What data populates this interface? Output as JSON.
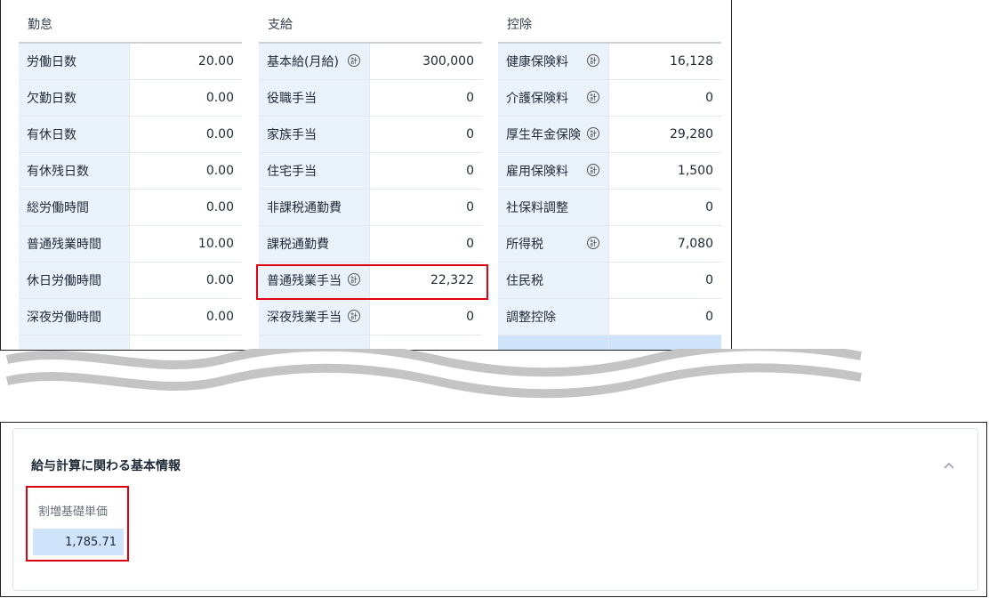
{
  "attendance": {
    "header": "勤怠",
    "rows": [
      {
        "label": "労働日数",
        "value": "20.00"
      },
      {
        "label": "欠勤日数",
        "value": "0.00"
      },
      {
        "label": "有休日数",
        "value": "0.00"
      },
      {
        "label": "有休残日数",
        "value": "0.00"
      },
      {
        "label": "総労働時間",
        "value": "0.00"
      },
      {
        "label": "普通残業時間",
        "value": "10.00"
      },
      {
        "label": "休日労働時間",
        "value": "0.00"
      },
      {
        "label": "深夜労働時間",
        "value": "0.00"
      }
    ]
  },
  "payment": {
    "header": "支給",
    "rows": [
      {
        "label": "基本給(月給)",
        "value": "300,000",
        "calc": true
      },
      {
        "label": "役職手当",
        "value": "0",
        "calc": false
      },
      {
        "label": "家族手当",
        "value": "0",
        "calc": false
      },
      {
        "label": "住宅手当",
        "value": "0",
        "calc": false
      },
      {
        "label": "非課税通勤費",
        "value": "0",
        "calc": false
      },
      {
        "label": "課税通勤費",
        "value": "0",
        "calc": false
      },
      {
        "label": "普通残業手当",
        "value": "22,322",
        "calc": true
      },
      {
        "label": "深夜残業手当",
        "value": "0",
        "calc": true
      }
    ]
  },
  "deduction": {
    "header": "控除",
    "rows": [
      {
        "label": "健康保険料",
        "value": "16,128",
        "calc": true
      },
      {
        "label": "介護保険料",
        "value": "0",
        "calc": true
      },
      {
        "label": "厚生年金保険",
        "value": "29,280",
        "calc": true
      },
      {
        "label": "雇用保険料",
        "value": "1,500",
        "calc": true
      },
      {
        "label": "社保料調整",
        "value": "0",
        "calc": false
      },
      {
        "label": "所得税",
        "value": "7,080",
        "calc": true
      },
      {
        "label": "住民税",
        "value": "0",
        "calc": false
      },
      {
        "label": "調整控除",
        "value": "0",
        "calc": false
      }
    ]
  },
  "calc_icon_glyph": "計",
  "basic_info": {
    "title": "給与計算に関わる基本情報",
    "field_label": "割増基礎単価",
    "field_value": "1,785.71"
  },
  "colors": {
    "highlight": "#e00012",
    "label_bg": "#eaf3fc",
    "selected_bg": "#cfe3fb"
  }
}
